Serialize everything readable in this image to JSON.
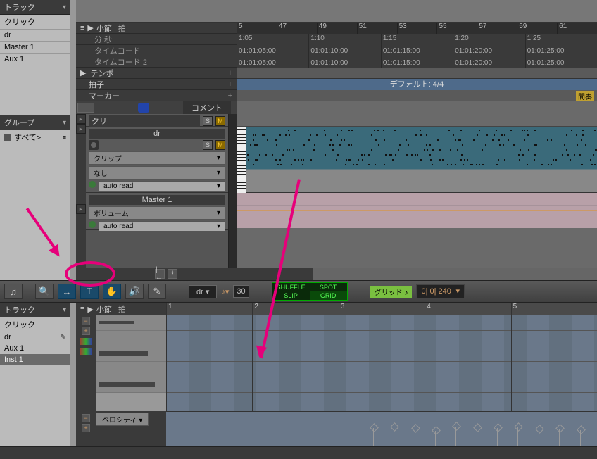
{
  "panels": {
    "tracks_header": "トラック",
    "groups_header": "グループ",
    "tracks": [
      "クリック",
      "dr",
      "Master 1",
      "Aux 1"
    ],
    "groups_all": "すべて>"
  },
  "ruler": {
    "bars_beats": "小節 | 拍",
    "min_sec": "分:秒",
    "timecode": "タイムコード",
    "timecode2": "タイムコード 2",
    "tempo": "テンポ",
    "meter": "拍子",
    "markers": "マーカー",
    "bar_numbers": [
      "5",
      "47",
      "49",
      "51",
      "53",
      "55",
      "57",
      "59",
      "61"
    ],
    "times": [
      {
        "ms": "1:05",
        "tc1": "01:01:05:00",
        "tc2": "01:01:05:00"
      },
      {
        "ms": "1:10",
        "tc1": "01:01:10:00",
        "tc2": "01:01:10:00"
      },
      {
        "ms": "1:15",
        "tc1": "01:01:15:00",
        "tc2": "01:01:15:00"
      },
      {
        "ms": "1:20",
        "tc1": "01:01:20:00",
        "tc2": "01:01:20:00"
      },
      {
        "ms": "1:25",
        "tc1": "01:01:25:00",
        "tc2": "01:01:25:00"
      }
    ],
    "meter_default": "デフォルト: 4/4",
    "marker_label": "間奏",
    "comment_col": "コメント"
  },
  "track_headers": {
    "kuri": {
      "name": "クリ",
      "s": "S",
      "m": "M"
    },
    "dr": {
      "name": "dr",
      "s": "S",
      "m": "M",
      "view": "クリップ",
      "insert": "なし",
      "auto": "auto read"
    },
    "master": {
      "name": "Master 1",
      "view": "ボリューム",
      "auto": "auto read"
    }
  },
  "toolbar": {
    "track_sel": "dr",
    "modes": {
      "shuffle": "SHUFFLE",
      "spot": "SPOT",
      "slip": "SLIP",
      "grid": "GRID"
    },
    "grid_chip": "グリッド",
    "counter": "0| 0| 240",
    "note_val": "30"
  },
  "midi_editor": {
    "tracks_header": "トラック",
    "tracks": [
      "クリック",
      "dr",
      "Aux 1",
      "Inst 1"
    ],
    "selected": "Inst 1",
    "bars_beats": "小節 | 拍",
    "bars": [
      "1",
      "2",
      "3",
      "4",
      "5"
    ],
    "velocity": "ベロシティ"
  },
  "icons": {
    "arrow": "▾",
    "plus": "+",
    "triangle": "▶",
    "note": "♫",
    "zoom": "🔍",
    "hand": "✋",
    "speaker": "🔊",
    "pen": "✎",
    "pointer": "↔",
    "ibeam": "⌶"
  }
}
